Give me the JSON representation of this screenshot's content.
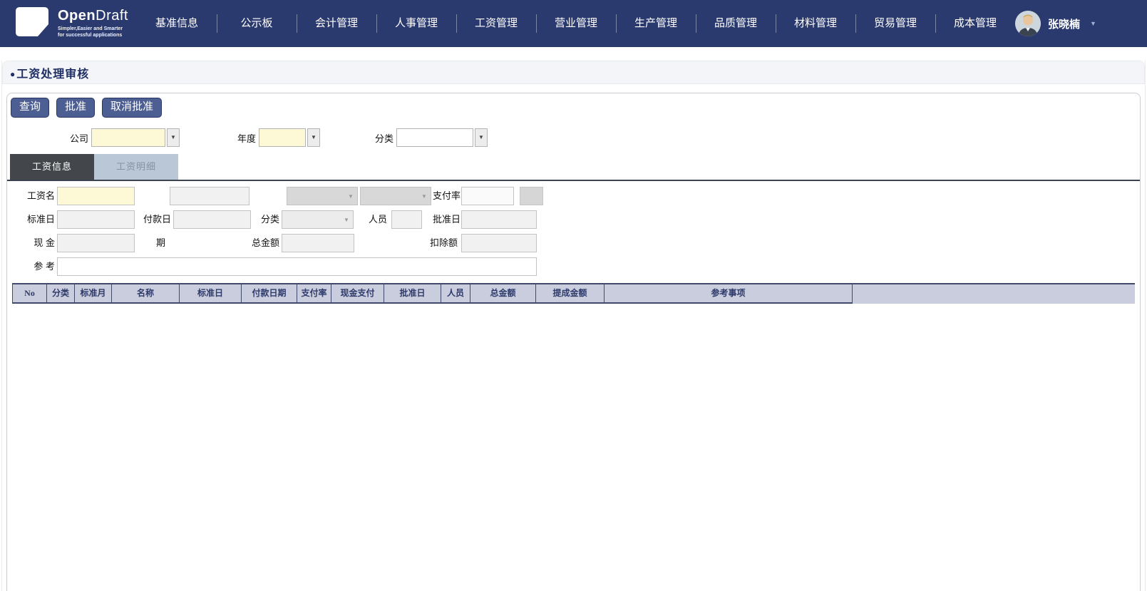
{
  "brand": {
    "name_bold": "Open",
    "name_light": "Draft",
    "tagline1": "Simpler,Easier and Smarter",
    "tagline2": "for successful applications"
  },
  "nav": {
    "items": [
      "基准信息",
      "公示板",
      "会计管理",
      "人事管理",
      "工资管理",
      "营业管理",
      "生产管理",
      "品质管理",
      "材料管理",
      "贸易管理",
      "成本管理"
    ],
    "user": {
      "name": "张晓楠"
    }
  },
  "page": {
    "bullet": "●",
    "title": "工资处理审核"
  },
  "toolbar": {
    "query": "查询",
    "approve": "批准",
    "cancel_approve": "取消批准"
  },
  "filters": {
    "company_label": "公司",
    "company_value": "",
    "year_label": "年度",
    "year_value": "",
    "category_label": "分类",
    "category_value": ""
  },
  "tabs": {
    "info": "工资信息",
    "detail": "工资明细"
  },
  "form": {
    "salary_name_label": "工资名",
    "pay_rate_label": "支付率",
    "standard_date_label": "标准日",
    "payment_date_label_line1": "付款日",
    "payment_date_label_line2": "期",
    "category_label": "分类",
    "personnel_label": "人员",
    "approval_date_label": "批准日",
    "cash_label": "现 金",
    "total_amount_label": "总金额",
    "deduction_label": "扣除额",
    "reference_label": "参 考"
  },
  "table": {
    "columns": [
      "No",
      "分类",
      "标准月",
      "名称",
      "标准日",
      "付款日期",
      "支付率",
      "现金支付",
      "批准日",
      "人员",
      "总金额",
      "提成金额",
      "参考事项"
    ],
    "rows": []
  },
  "icons": {
    "dropdown": "▼",
    "user_caret": "▼"
  },
  "colors": {
    "nav_bg": "#2b3a6e",
    "button_bg": "#4d5e92",
    "tab_active_bg": "#43474b",
    "tab_inactive_bg": "#b9c7d6",
    "table_header_bg": "#c9cdde",
    "field_yellow": "#fdf9d6",
    "title_text": "#1f2f66"
  }
}
